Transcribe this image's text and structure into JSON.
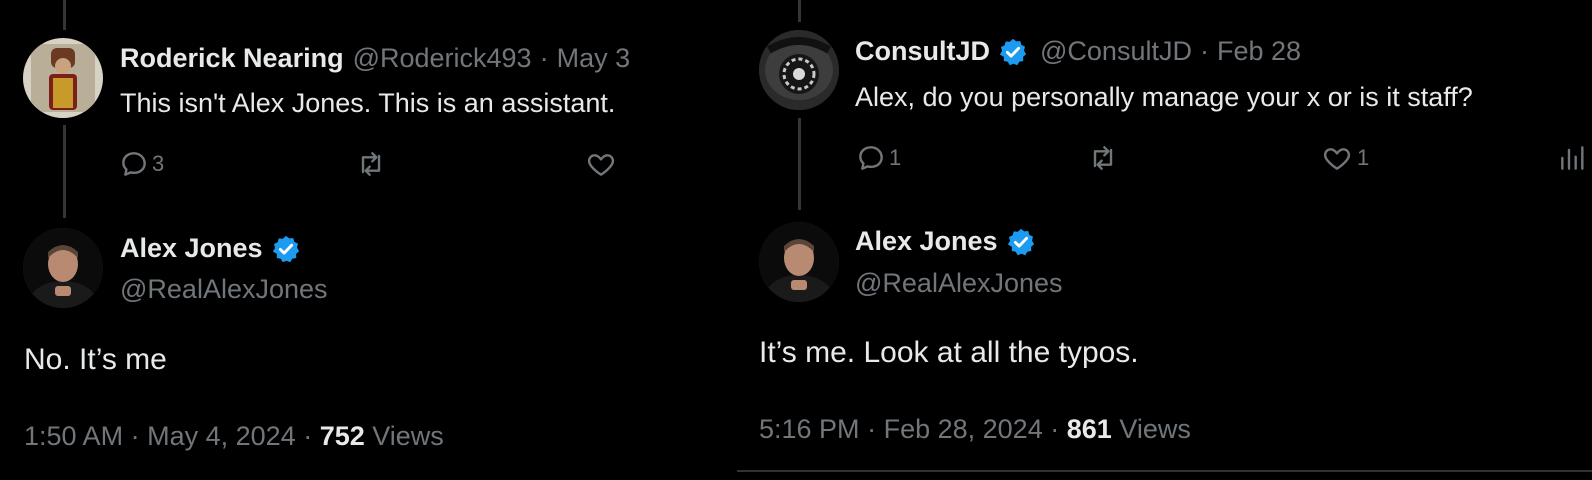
{
  "left": {
    "reply": {
      "name": "Roderick Nearing",
      "handle": "@Roderick493",
      "sep": "·",
      "date": "May 3",
      "text": "This isn't Alex Jones. This is an assistant.",
      "replies": "3",
      "likes": ""
    },
    "main": {
      "name": "Alex Jones",
      "handle": "@RealAlexJones",
      "text": "No. It’s me",
      "time": "1:50 AM",
      "date": "May 4, 2024",
      "views_count": "752",
      "views_label": "Views"
    }
  },
  "right": {
    "reply": {
      "name": "ConsultJD",
      "handle": "@ConsultJD",
      "sep": "·",
      "date": "Feb 28",
      "text": "Alex, do you personally manage your x or is it staff?",
      "replies": "1",
      "likes": "1"
    },
    "main": {
      "name": "Alex Jones",
      "handle": "@RealAlexJones",
      "text": "It’s me. Look at all the typos.",
      "time": "5:16 PM",
      "date": "Feb 28, 2024",
      "views_count": "861",
      "views_label": "Views"
    }
  },
  "colors": {
    "background": "#000000",
    "text": "#e7e9ea",
    "muted": "#71767b",
    "verified": "#1d9bf0"
  }
}
